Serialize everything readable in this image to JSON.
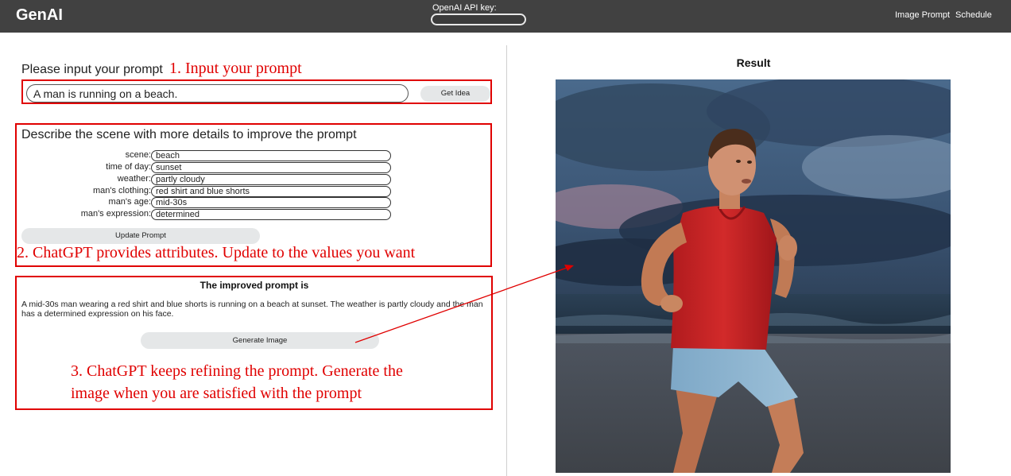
{
  "app": {
    "brand": "GenAI"
  },
  "header": {
    "api_key_label": "OpenAI API key:",
    "api_key_value": "",
    "nav": [
      "Image Prompt",
      "Schedule"
    ]
  },
  "prompt": {
    "label": "Please input your prompt",
    "value": "A man is running on a beach.",
    "get_idea_label": "Get Idea"
  },
  "details": {
    "title": "Describe the scene with more details to improve the prompt",
    "attributes": [
      {
        "label": "scene:",
        "value": "beach"
      },
      {
        "label": "time of day:",
        "value": "sunset"
      },
      {
        "label": "weather:",
        "value": "partly cloudy"
      },
      {
        "label": "man's clothing:",
        "value": "red shirt and blue shorts"
      },
      {
        "label": "man's age:",
        "value": "mid-30s"
      },
      {
        "label": "man's expression:",
        "value": "determined"
      }
    ],
    "update_label": "Update Prompt"
  },
  "improved": {
    "title": "The improved prompt is",
    "text": "A mid-30s man wearing a red shirt and blue shorts is running on a beach at sunset. The weather is partly cloudy and the man has a determined expression on his face.",
    "generate_label": "Generate Image"
  },
  "result": {
    "title": "Result"
  },
  "annotations": {
    "step1": "1. Input your prompt",
    "step2": "2. ChatGPT provides attributes. Update to the values you want",
    "step3_line1": "3. ChatGPT keeps refining the prompt. Generate the",
    "step3_line2": "image when you are satisfied with the prompt"
  },
  "colors": {
    "topbar": "#414141",
    "annotation_red": "#e00000",
    "button_gray": "#e5e7e8"
  }
}
